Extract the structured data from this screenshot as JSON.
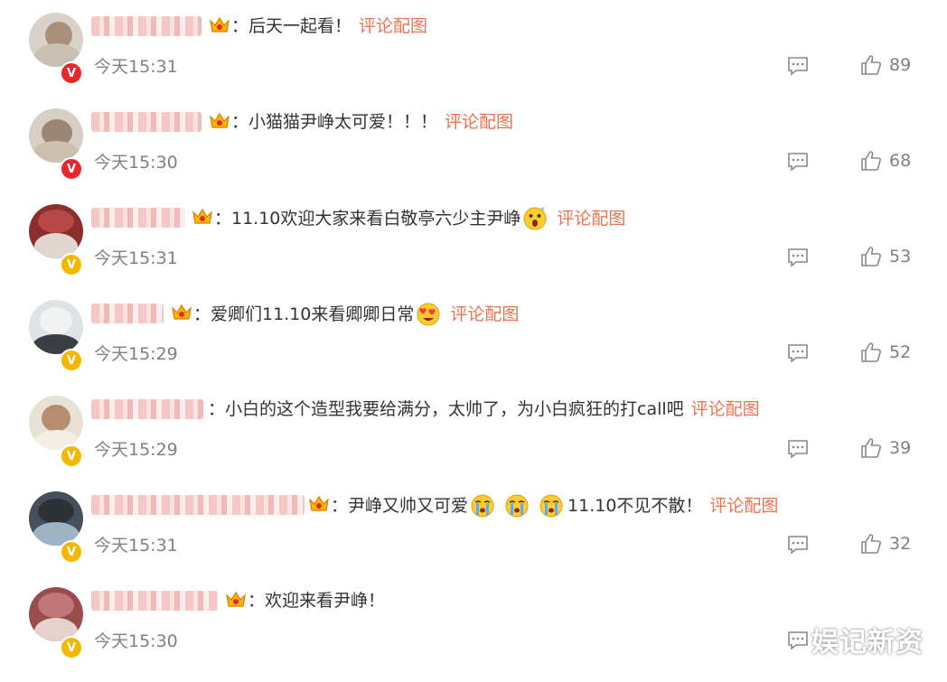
{
  "comments": [
    {
      "text": "：后天一起看！",
      "time": "今天15:31",
      "likes": "89",
      "badge": "red",
      "pic_link": "评论配图",
      "emojis": []
    },
    {
      "text": "：小猫猫尹峥太可爱！！！",
      "time": "今天15:30",
      "likes": "68",
      "badge": "red",
      "pic_link": "评论配图",
      "emojis": []
    },
    {
      "text": "：11.10欢迎大家来看白敬亭六少主尹峥",
      "time": "今天15:31",
      "likes": "53",
      "badge": "gold",
      "pic_link": "评论配图",
      "emojis": [
        "surprised-emoji"
      ]
    },
    {
      "text": "：爱卿们11.10来看卿卿日常",
      "time": "今天15:29",
      "likes": "52",
      "badge": "gold",
      "pic_link": "评论配图",
      "emojis": [
        "love-eyes-emoji"
      ]
    },
    {
      "text": "：小白的这个造型我要给满分，太帅了，为小白疯狂的打call吧",
      "time": "今天15:29",
      "likes": "39",
      "badge": "gold",
      "pic_link": "评论配图",
      "emojis": []
    },
    {
      "text": "：尹峥又帅又可爱",
      "text2": "11.10不见不散！",
      "time": "今天15:31",
      "likes": "32",
      "badge": "gold",
      "pic_link": "评论配图",
      "emojis": [
        "crying-emoji",
        "crying-emoji",
        "crying-emoji"
      ]
    },
    {
      "text": "：欢迎来看尹峥！",
      "time": "今天15:30",
      "likes": "",
      "badge": "gold",
      "pic_link": "",
      "emojis": []
    }
  ],
  "badge_labels": {
    "red": "V",
    "gold": "V"
  },
  "colors": {
    "link": "#eb7350",
    "badge_red": "#e8262b",
    "badge_gold": "#f5b800",
    "text": "#333333",
    "meta": "#808080"
  },
  "icons": {
    "reply": "comment-icon",
    "like": "thumbs-up-icon",
    "crown": "crown-icon"
  },
  "watermark": "娱记新资"
}
